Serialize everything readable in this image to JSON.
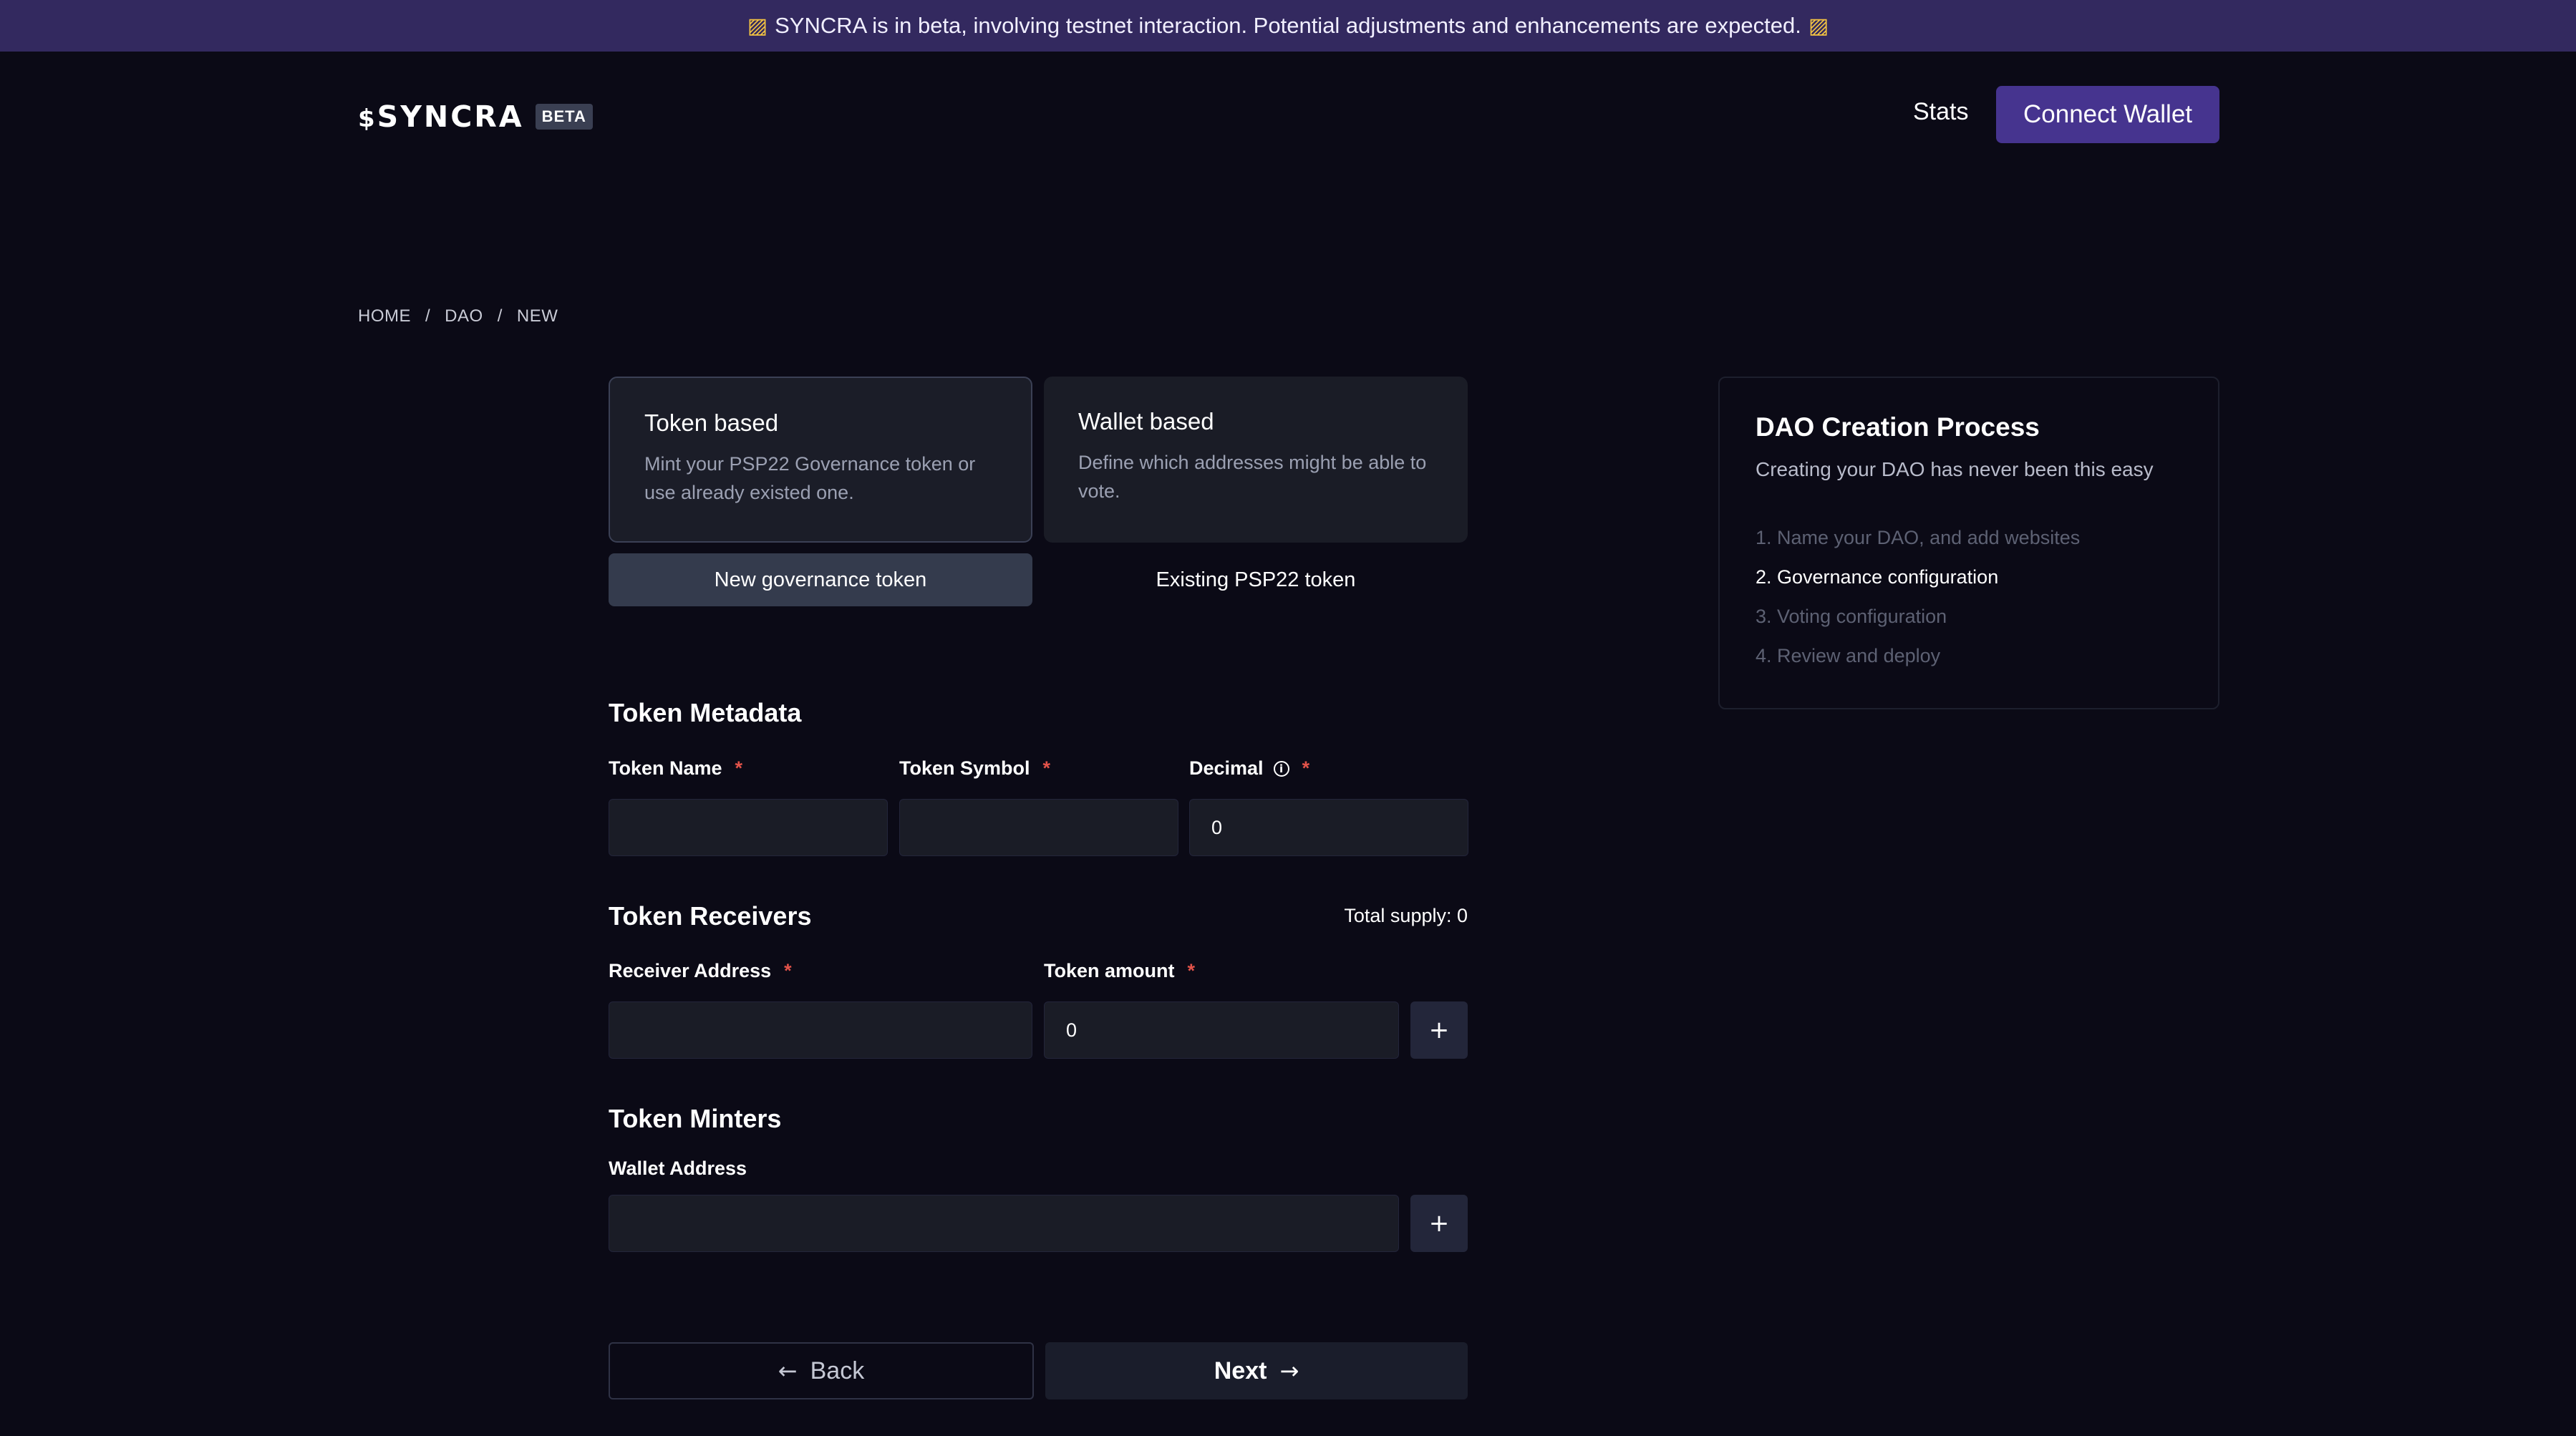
{
  "banner": {
    "icon": "construction-icon",
    "text": "SYNCRA is in beta, involving testnet interaction. Potential adjustments and enhancements are expected."
  },
  "header": {
    "logo_text": "SYNCRA",
    "beta_badge": "BETA",
    "nav_stats": "Stats",
    "connect_wallet": "Connect Wallet"
  },
  "breadcrumb": {
    "items": [
      "HOME",
      "DAO",
      "NEW"
    ],
    "separator": "/"
  },
  "governance_type": {
    "token_based": {
      "title": "Token based",
      "description": "Mint your PSP22 Governance token or use already existed one."
    },
    "wallet_based": {
      "title": "Wallet based",
      "description": "Define which addresses might be able to vote."
    },
    "new_token_label": "New governance token",
    "existing_token_label": "Existing PSP22 token"
  },
  "token_metadata": {
    "title": "Token Metadata",
    "name_label": "Token Name",
    "symbol_label": "Token Symbol",
    "decimal_label": "Decimal",
    "decimal_value": "0",
    "required_mark": "*"
  },
  "token_receivers": {
    "title": "Token Receivers",
    "total_supply": "Total supply: 0",
    "address_label": "Receiver Address",
    "amount_label": "Token amount",
    "amount_value": "0",
    "add_label": "+"
  },
  "token_minters": {
    "title": "Token Minters",
    "wallet_label": "Wallet Address",
    "add_label": "+"
  },
  "footer": {
    "back": "Back",
    "next": "Next"
  },
  "process": {
    "title": "DAO Creation Process",
    "subtitle": "Creating your DAO has never been this easy",
    "steps": [
      "1. Name your DAO, and add websites",
      "2. Governance configuration",
      "3. Voting configuration",
      "4. Review and deploy"
    ]
  },
  "colors": {
    "background": "#0b0a16",
    "banner": "#33295f",
    "accent": "#46348f",
    "required": "#e2534a"
  }
}
